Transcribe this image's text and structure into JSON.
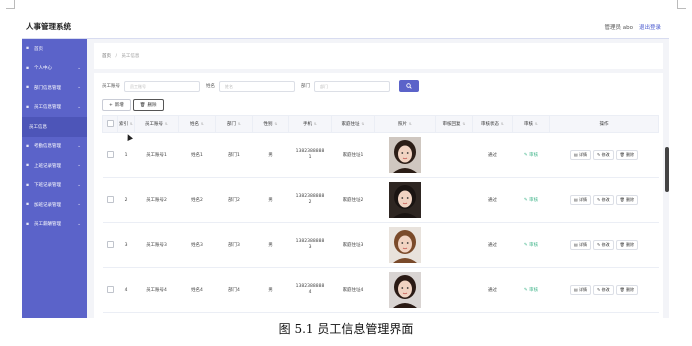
{
  "app": {
    "title": "人事管理系统",
    "user_label": "管理员 abo",
    "logout_label": "退出登录"
  },
  "sidebar": {
    "items": [
      {
        "label": "首页",
        "icon": "home-icon",
        "has_children": false
      },
      {
        "label": "个人中心",
        "icon": "user-icon",
        "has_children": true
      },
      {
        "label": "部门信息管理",
        "icon": "grid-icon",
        "has_children": true
      },
      {
        "label": "员工信息管理",
        "icon": "grid-icon",
        "has_children": true
      },
      {
        "label": "员工信息",
        "icon": "",
        "has_children": false,
        "sub": true
      },
      {
        "label": "考勤信息管理",
        "icon": "grid-icon",
        "has_children": true
      },
      {
        "label": "上班记录管理",
        "icon": "grid-icon",
        "has_children": true
      },
      {
        "label": "下班记录管理",
        "icon": "grid-icon",
        "has_children": true
      },
      {
        "label": "加班记录管理",
        "icon": "grid-icon",
        "has_children": true
      },
      {
        "label": "员工薪酬管理",
        "icon": "grid-icon",
        "has_children": true
      }
    ]
  },
  "breadcrumb": {
    "home": "首页",
    "separator": "/",
    "current": "员工信息"
  },
  "search": {
    "fields": [
      {
        "label": "员工账号",
        "placeholder": "员工账号"
      },
      {
        "label": "姓名",
        "placeholder": "姓名"
      },
      {
        "label": "部门",
        "placeholder": "部门"
      }
    ],
    "button_icon": "search-icon"
  },
  "actions": {
    "add_label": "新增",
    "delete_label": "删除"
  },
  "table": {
    "columns": [
      "索引",
      "员工账号",
      "姓名",
      "部门",
      "性别",
      "手机",
      "家庭住址",
      "照片",
      "审核回复",
      "审核状态",
      "审核",
      "操作"
    ],
    "audit_label": "审核",
    "row_actions": {
      "detail": "详情",
      "edit": "修改",
      "delete": "删除"
    },
    "rows": [
      {
        "index": "1",
        "account": "员工账号1",
        "name": "姓名1",
        "dept": "部门1",
        "gender": "男",
        "phone": "13823888881",
        "address": "家庭住址1",
        "reply": "",
        "status": "通过"
      },
      {
        "index": "2",
        "account": "员工账号2",
        "name": "姓名2",
        "dept": "部门2",
        "gender": "男",
        "phone": "13823888882",
        "address": "家庭住址2",
        "reply": "",
        "status": "通过"
      },
      {
        "index": "3",
        "account": "员工账号3",
        "name": "姓名3",
        "dept": "部门3",
        "gender": "男",
        "phone": "13823888883",
        "address": "家庭住址3",
        "reply": "",
        "status": "通过"
      },
      {
        "index": "4",
        "account": "员工账号4",
        "name": "姓名4",
        "dept": "部门4",
        "gender": "男",
        "phone": "13823888884",
        "address": "家庭住址4",
        "reply": "",
        "status": "通过"
      }
    ]
  },
  "caption": "图 5.1  员工信息管理界面",
  "colors": {
    "sidebar": "#5b63c9",
    "accent": "#5b63c9",
    "audit": "#3eb489"
  }
}
